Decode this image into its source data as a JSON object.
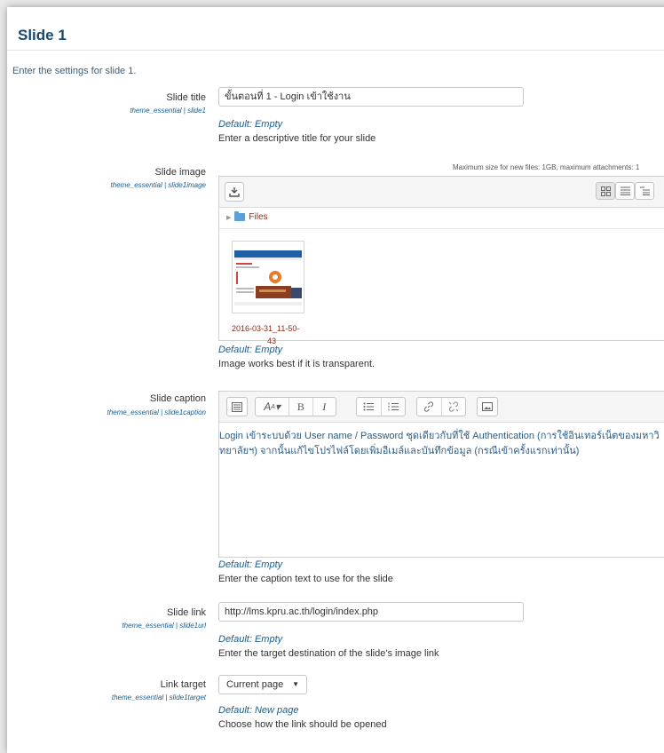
{
  "section": {
    "title": "Slide 1",
    "intro": "Enter the settings for slide 1."
  },
  "slide_title": {
    "label": "Slide title",
    "setting": "theme_essential | slide1",
    "value": "ขั้นตอนที่ 1 - Login เข้าใช้งาน",
    "default": "Default: Empty",
    "description": "Enter a descriptive title for your slide"
  },
  "slide_image": {
    "label": "Slide image",
    "setting": "theme_essential | slide1image",
    "max_size": "Maximum size for new files: 1GB, maximum attachments: 1",
    "path_label": "Files",
    "file_name": "2016-03-31_11-50-",
    "file_name_cont": "43",
    "default": "Default: Empty",
    "description": "Image works best if it is transparent."
  },
  "slide_caption": {
    "label": "Slide caption",
    "setting": "theme_essential | slide1caption",
    "value": "Login เข้าระบบด้วย User name / Password ชุดเดียวกับที่ใช้ Authentication (การใช้อินเทอร์เน็ตของมหาวิทยาลัยฯ) จากนั้นแก้ไขโปรไฟล์โดยเพิ่มอีเมล์และบันทึกข้อมูล (กรณีเข้าครั้งแรกเท่านั้น)",
    "default": "Default: Empty",
    "description": "Enter the caption text to use for the slide"
  },
  "slide_link": {
    "label": "Slide link",
    "setting": "theme_essential | slide1url",
    "value": "http://lms.kpru.ac.th/login/index.php",
    "default": "Default: Empty",
    "description": "Enter the target destination of the slide's image link"
  },
  "link_target": {
    "label": "Link target",
    "setting": "theme_essential | slide1target",
    "value": "Current page",
    "default": "Default: New page",
    "description": "Choose how the link should be opened"
  }
}
